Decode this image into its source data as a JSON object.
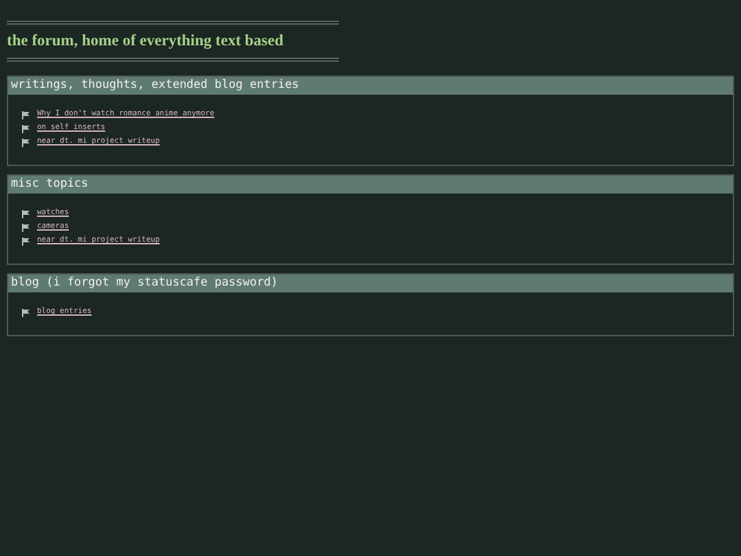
{
  "title": "the forum, home of everything text based",
  "sections": [
    {
      "heading": "writings, thoughts, extended blog entries",
      "links": [
        "Why I don't watch romance anime anymore",
        "on self inserts",
        "near dt. mi project writeup"
      ]
    },
    {
      "heading": "misc topics",
      "links": [
        "watches",
        "cameras",
        "near dt. mi project writeup"
      ]
    },
    {
      "heading": "blog (i forgot my statuscafe password)",
      "links": [
        "blog entries"
      ]
    }
  ]
}
